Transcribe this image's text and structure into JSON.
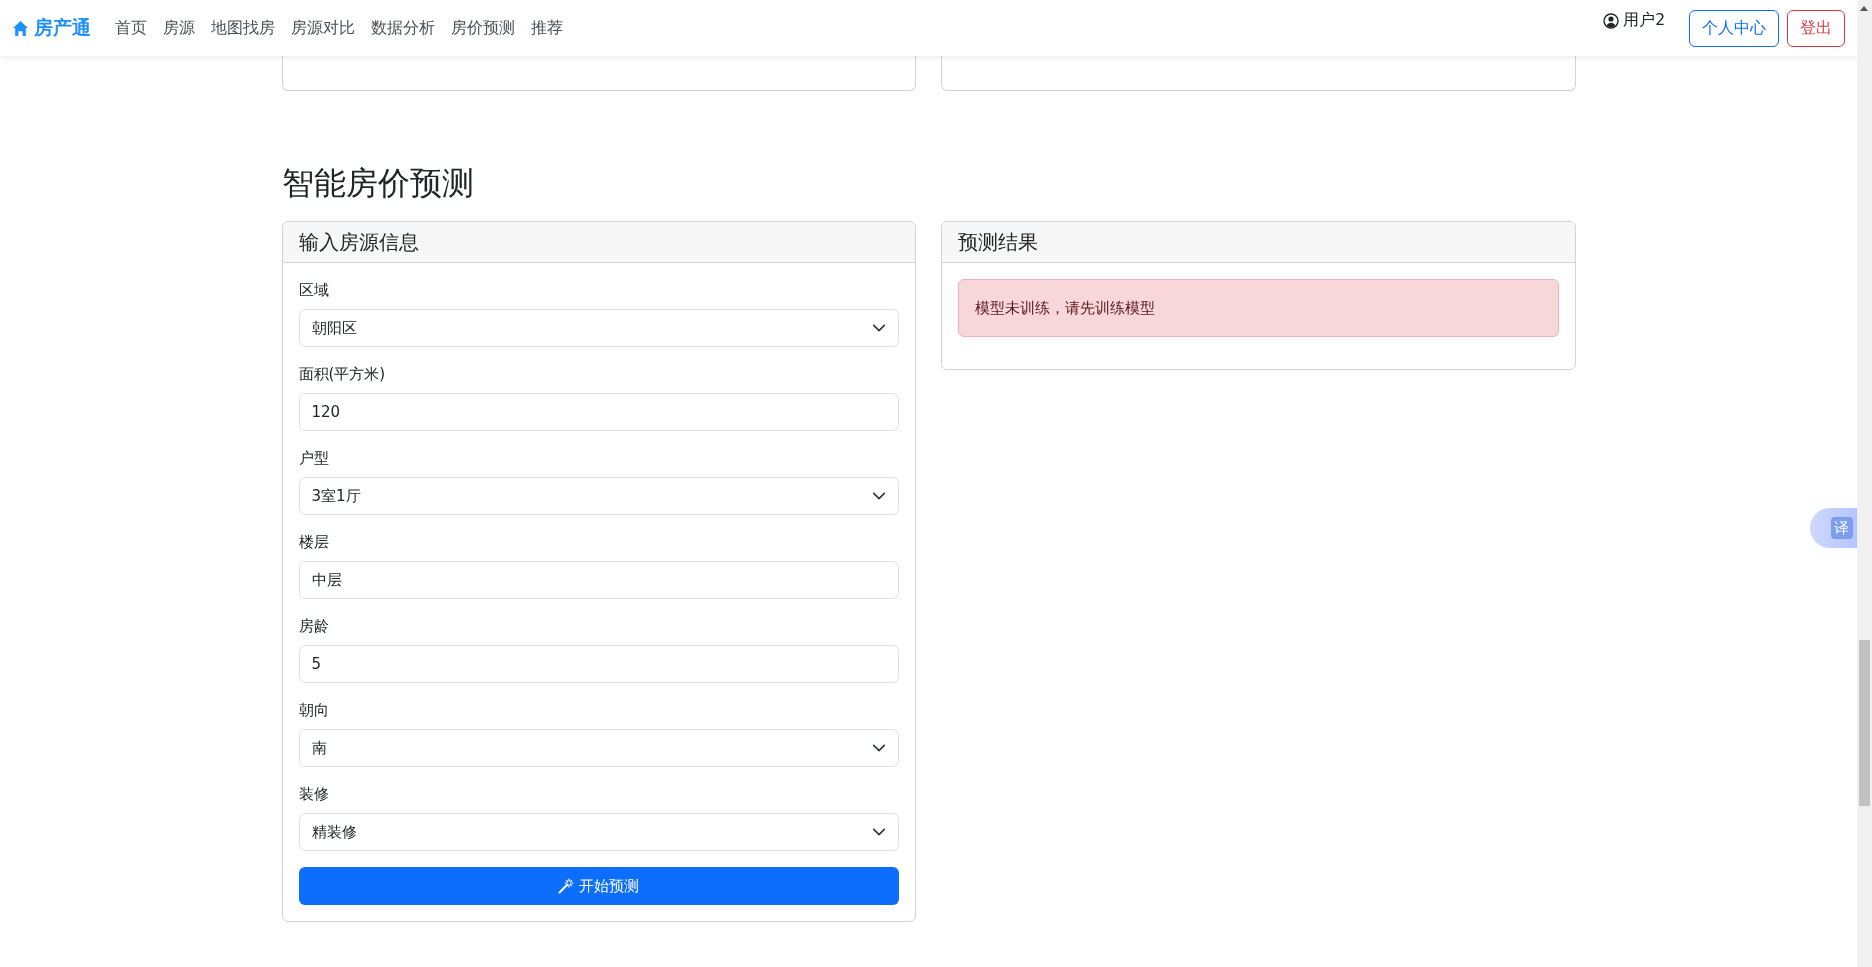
{
  "navbar": {
    "brand": "房产通",
    "items": [
      {
        "label": "首页"
      },
      {
        "label": "房源"
      },
      {
        "label": "地图找房"
      },
      {
        "label": "房源对比"
      },
      {
        "label": "数据分析"
      },
      {
        "label": "房价预测"
      },
      {
        "label": "推荐"
      }
    ],
    "user": "用户2",
    "buttons": [
      {
        "label": "个人中心",
        "kind": "primary"
      },
      {
        "label": "登出",
        "kind": "danger"
      }
    ]
  },
  "heading": "智能房价预测",
  "form_card": {
    "title": "输入房源信息",
    "fields": [
      {
        "label": "区域",
        "kind": "select",
        "value": "朝阳区"
      },
      {
        "label": "面积(平方米)",
        "kind": "input",
        "value": "120"
      },
      {
        "label": "户型",
        "kind": "select",
        "value": "3室1厅"
      },
      {
        "label": "楼层",
        "kind": "input",
        "value": "中层"
      },
      {
        "label": "房龄",
        "kind": "input",
        "value": "5"
      },
      {
        "label": "朝向",
        "kind": "select",
        "value": "南"
      },
      {
        "label": "装修",
        "kind": "select",
        "value": "精装修"
      }
    ],
    "submit": "开始预测"
  },
  "result_card": {
    "title": "预测结果",
    "alert": "模型未训练，请先训练模型"
  },
  "translate_button": "译"
}
